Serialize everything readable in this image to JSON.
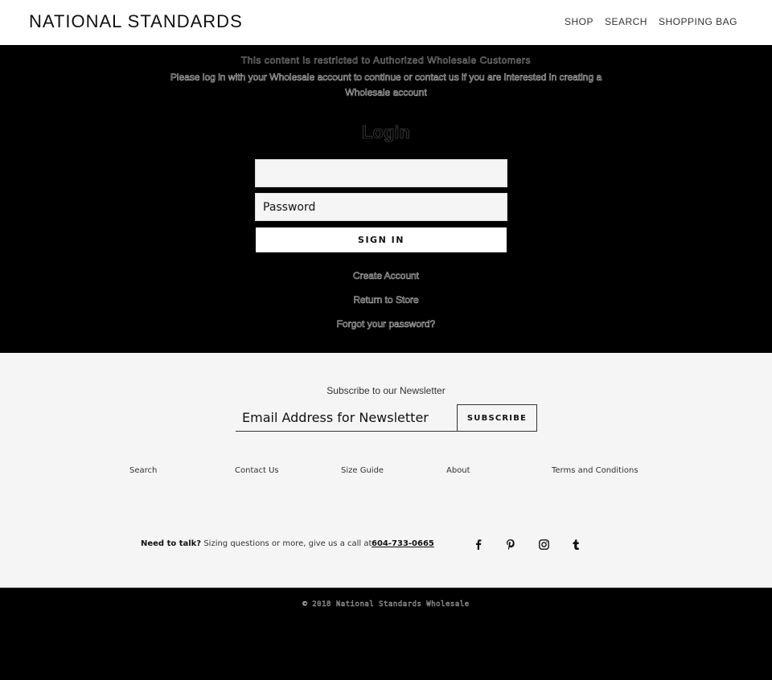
{
  "header": {
    "logo": "NATIONAL STANDARDS",
    "nav": [
      {
        "label": "SHOP"
      },
      {
        "label": "SEARCH"
      },
      {
        "label": "SHOPPING BAG"
      }
    ]
  },
  "login": {
    "notice_title": "This content is restricted to Authorized Wholesale Customers",
    "notice_body": "Please log in with your Wholesale account to continue or contact us if you are interested in creating a Wholesale account",
    "title": "Login",
    "email_value": "",
    "email_placeholder": "",
    "password_placeholder": "Password",
    "sign_in_label": "SIGN IN",
    "links": {
      "create_account": "Create Account",
      "return_to_store": "Return to Store",
      "forgot_password": "Forgot your password?"
    }
  },
  "footer": {
    "newsletter_title": "Subscribe to our Newsletter",
    "newsletter_placeholder": "Email Address for Newsletter",
    "subscribe_label": "SUBSCRIBE",
    "links": [
      {
        "label": "Search"
      },
      {
        "label": "Contact Us"
      },
      {
        "label": "Size Guide"
      },
      {
        "label": "About"
      },
      {
        "label": "Terms and Conditions"
      }
    ],
    "contact": {
      "lead": "Need to talk?",
      "text": "Sizing questions or more, give us a call at",
      "phone": "604-733-0665"
    },
    "social": [
      {
        "icon": "facebook-icon"
      },
      {
        "icon": "pinterest-icon"
      },
      {
        "icon": "instagram-icon"
      },
      {
        "icon": "tumblr-icon"
      }
    ]
  },
  "bottom": {
    "copyright": "© 2018 National Standards Wholesale"
  }
}
